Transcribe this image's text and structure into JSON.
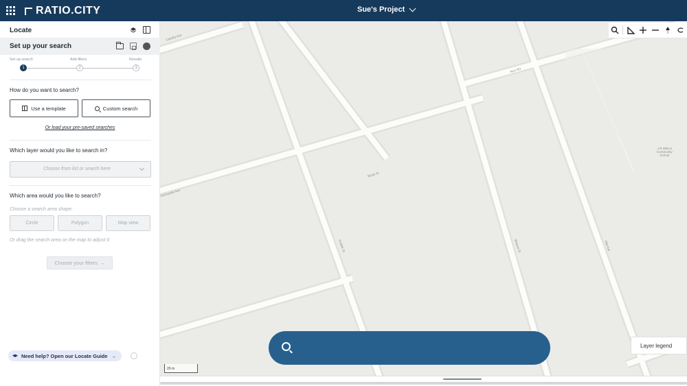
{
  "topbar": {
    "logo_text": "RATIO.CITY",
    "project_name": "Sue's Project",
    "brand_color": "#163a5c"
  },
  "panel": {
    "title": "Locate",
    "setup_title": "Set up your search",
    "steps": [
      {
        "label": "Set up search",
        "number": "1",
        "state": "active"
      },
      {
        "label": "Add filters",
        "number": "2",
        "state": "idle"
      },
      {
        "label": "Results",
        "number": "3",
        "state": "idle"
      }
    ],
    "q_search": "How do you want to search?",
    "btn_template": "Use a template",
    "btn_custom": "Custom search",
    "link_saved": "Or load your pre-saved searches",
    "q_layer": "Which layer would you like to search in?",
    "layer_placeholder": "Choose from list or search here",
    "q_area": "Which area would you like to search?",
    "area_hint": "Choose a search area shape:",
    "shapes": [
      "Circle",
      "Polygon",
      "Map view"
    ],
    "drag_hint": "Or drag the search area on the map to adjust it",
    "filters_btn": "Choose your filters",
    "filters_arrow": "→",
    "help_text": "Need help? Open our Locate Guide",
    "help_arrow": "→"
  },
  "map": {
    "street_labels": [
      "Boyle St",
      "Avro Rd",
      "Cavalry Ave",
      "Kodiak St",
      "Sunnyside Ave",
      "Winona St",
      "Alfa Ave"
    ],
    "poi_label": [
      "J R Wilcox",
      "Community",
      "School"
    ],
    "scale_label": "20 m",
    "legend_label": "Layer legend",
    "search_color": "#27608d"
  }
}
